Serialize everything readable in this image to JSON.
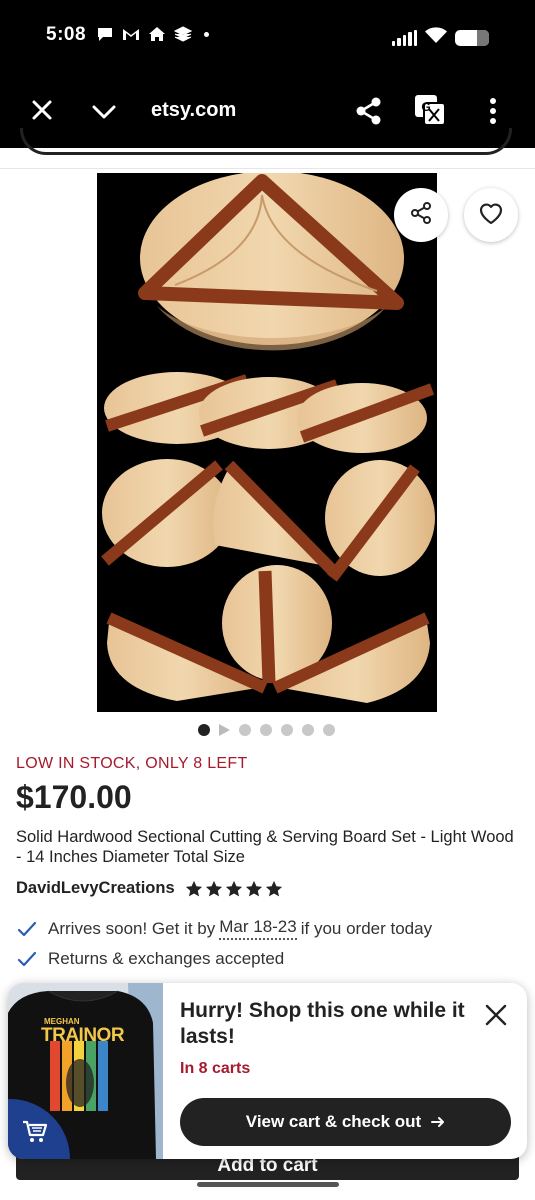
{
  "status_bar": {
    "time": "5:08"
  },
  "browser": {
    "url": "etsy.com"
  },
  "listing": {
    "stock_notice": "LOW IN STOCK, ONLY 8 LEFT",
    "price": "$170.00",
    "title": "Solid Hardwood Sectional Cutting & Serving Board Set - Light Wood - 14 Inches Diameter Total Size",
    "shop_name": "DavidLevyCreations",
    "rating_stars": 5,
    "image_count": 7,
    "active_image": 1
  },
  "benefits": {
    "arrives_prefix": "Arrives soon! Get it by",
    "arrives_date": "Mar 18-23",
    "arrives_suffix": "if you order today",
    "returns": "Returns & exchanges accepted"
  },
  "add_to_cart_label": "Add to cart",
  "popup": {
    "title": "Hurry! Shop this one while it lasts!",
    "carts_text": "In 8 carts",
    "button_label": "View cart & check out",
    "shirt_top_text": "MEGHAN",
    "shirt_main_text": "TRAINOR"
  },
  "colors": {
    "accent_red": "#a61a2e",
    "dark": "#222222",
    "cart_badge": "#1f3f8f"
  },
  "icons": [
    "close-icon",
    "chevron-down-icon",
    "share-icon",
    "translate-icon",
    "more-vert-icon",
    "heart-icon",
    "star-icon",
    "check-icon",
    "arrow-right-icon",
    "cart-icon"
  ]
}
